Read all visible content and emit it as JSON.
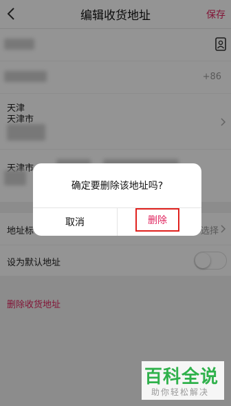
{
  "nav": {
    "title": "编辑收货地址",
    "save": "保存"
  },
  "phone": {
    "prefix": "+86"
  },
  "region": {
    "province": "天津",
    "city": "天津市"
  },
  "address": {
    "text_start": "天津市"
  },
  "tag_row": {
    "label": "地址标",
    "placeholder": "选择"
  },
  "default_row": {
    "label": "设为默认地址"
  },
  "delete_link": "删除收货地址",
  "dialog": {
    "message": "确定要删除该地址吗?",
    "cancel": "取消",
    "confirm": "删除"
  },
  "watermark": {
    "title": "百科全说",
    "subtitle": "助你轻松解决"
  },
  "colors": {
    "accent": "#e0245e",
    "highlight_box": "#e0201d",
    "watermark_green": "#2fb14b"
  }
}
